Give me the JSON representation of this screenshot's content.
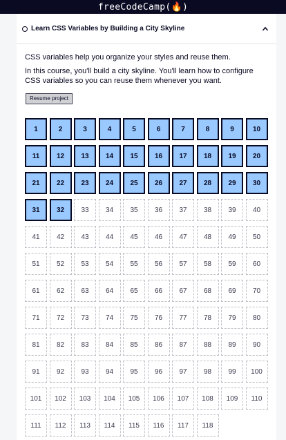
{
  "brand": {
    "title": "freeCodeCamp(🔥)"
  },
  "section": {
    "title": "Learn CSS Variables by Building a City Skyline",
    "expanded_icon": "caret-up-icon"
  },
  "intro": {
    "p1": "CSS variables help you organize your styles and reuse them.",
    "p2": "In this course, you'll build a city skyline. You'll learn how to configure CSS variables so you can reuse them whenever you want."
  },
  "resume_label": "Resume project",
  "steps": {
    "total": 118,
    "completed": 32,
    "labels": [
      "1",
      "2",
      "3",
      "4",
      "5",
      "6",
      "7",
      "8",
      "9",
      "10",
      "11",
      "12",
      "13",
      "14",
      "15",
      "16",
      "17",
      "18",
      "19",
      "20",
      "21",
      "22",
      "23",
      "24",
      "25",
      "26",
      "27",
      "28",
      "29",
      "30",
      "31",
      "32",
      "33",
      "34",
      "35",
      "36",
      "37",
      "38",
      "39",
      "40",
      "41",
      "42",
      "43",
      "44",
      "45",
      "46",
      "47",
      "48",
      "49",
      "50",
      "51",
      "52",
      "53",
      "54",
      "55",
      "56",
      "57",
      "58",
      "59",
      "60",
      "61",
      "62",
      "63",
      "64",
      "65",
      "66",
      "67",
      "68",
      "69",
      "70",
      "71",
      "72",
      "73",
      "74",
      "75",
      "76",
      "77",
      "78",
      "79",
      "80",
      "81",
      "82",
      "83",
      "84",
      "85",
      "86",
      "87",
      "88",
      "89",
      "90",
      "91",
      "92",
      "93",
      "94",
      "95",
      "96",
      "97",
      "98",
      "99",
      "100",
      "101",
      "102",
      "103",
      "104",
      "105",
      "106",
      "107",
      "108",
      "109",
      "110",
      "111",
      "112",
      "113",
      "114",
      "115",
      "116",
      "117",
      "118"
    ]
  },
  "colors": {
    "completed_fill": "#99c9ff",
    "dark": "#0a0a23"
  }
}
